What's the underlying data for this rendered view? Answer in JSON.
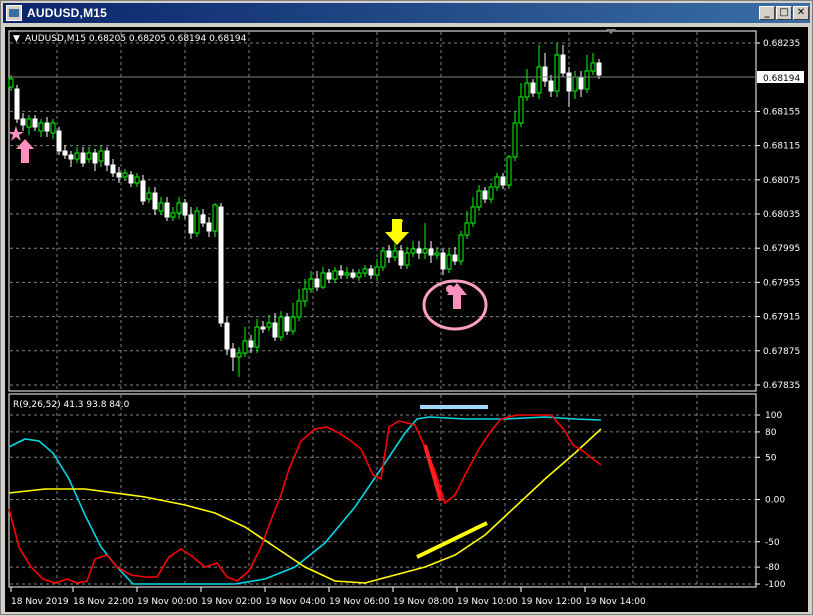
{
  "window": {
    "title": "AUDUSD,M15",
    "minimize_glyph": "_",
    "maximize_glyph": "□",
    "close_glyph": "✕"
  },
  "chart": {
    "info_marker": "▼",
    "info_text": "AUDUSD,M15  0.68205 0.68205 0.68194 0.68194",
    "current_price": "0.68194",
    "price_ticks": [
      "0.68235",
      "0.68194",
      "0.68155",
      "0.68115",
      "0.68075",
      "0.68035",
      "0.67995",
      "0.67955",
      "0.67915",
      "0.67875",
      "0.67835"
    ],
    "indicator_label": "R(9,26,52) 41.3 93.8 84.0",
    "indicator_ticks": [
      "100",
      "80",
      "50",
      "0.00",
      "-50",
      "-80",
      "-100"
    ],
    "time_ticks": [
      "18 Nov 2019",
      "18 Nov 22:00",
      "19 Nov 00:00",
      "19 Nov 02:00",
      "19 Nov 04:00",
      "19 Nov 06:00",
      "19 Nov 08:00",
      "19 Nov 10:00",
      "19 Nov 12:00",
      "19 Nov 14:00"
    ]
  },
  "colors": {
    "background": "#000000",
    "candle_bull": "#ffffff",
    "candle_bear": "#00ff00",
    "grid": "#808080",
    "rsi_fast": "#ff0000",
    "rsi_mid": "#00d7e6",
    "rsi_slow": "#ffff00",
    "annotation_pink": "#ff8fbf",
    "annotation_yellow": "#ffff00",
    "annotation_blue": "#a0d8ff"
  },
  "icons": [
    "pink-star-icon",
    "pink-up-arrow-icon",
    "yellow-down-arrow-icon",
    "pink-up-arrow-icon-2"
  ]
}
